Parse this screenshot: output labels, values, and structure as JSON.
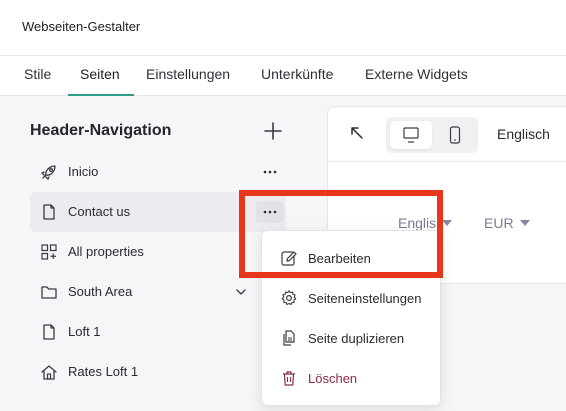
{
  "app": {
    "title": "Webseiten-Gestalter"
  },
  "tabs": [
    {
      "label": "Stile"
    },
    {
      "label": "Seiten"
    },
    {
      "label": "Einstellungen"
    },
    {
      "label": "Unterkünfte"
    },
    {
      "label": "Externe Widgets"
    }
  ],
  "active_tab": "Seiten",
  "sidebar": {
    "title": "Header-Navigation",
    "add_icon": "plus-icon",
    "items": [
      {
        "label": "Inicio",
        "icon": "rocket-icon"
      },
      {
        "label": "Contact us",
        "icon": "page-icon"
      },
      {
        "label": "All properties",
        "icon": "grid-add-icon"
      },
      {
        "label": "South Area",
        "icon": "folder-icon"
      },
      {
        "label": "Loft 1",
        "icon": "page-icon"
      },
      {
        "label": "Rates Loft 1",
        "icon": "house-icon"
      }
    ]
  },
  "preview": {
    "language_label": "Englisch",
    "language_select": "Englis",
    "currency_select": "EUR"
  },
  "context_menu": {
    "items": [
      {
        "label": "Bearbeiten",
        "icon": "edit-icon"
      },
      {
        "label": "Seiteneinstellungen",
        "icon": "gear-icon"
      },
      {
        "label": "Seite duplizieren",
        "icon": "duplicate-icon"
      },
      {
        "label": "Löschen",
        "icon": "trash-icon"
      }
    ]
  },
  "colors": {
    "accent": "#2e9c86",
    "danger": "#8a2b45",
    "highlight": "#e8361d",
    "muted_select": "#7b7a98"
  }
}
